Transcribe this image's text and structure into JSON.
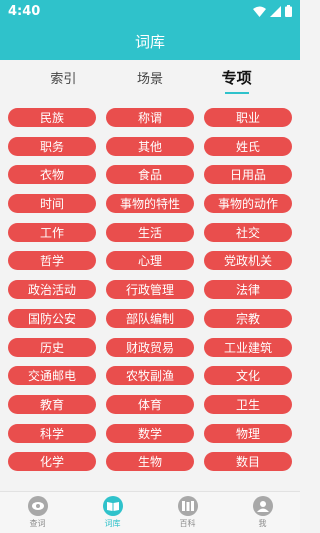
{
  "status": {
    "time": "4:40"
  },
  "header": {
    "title": "词库"
  },
  "tabs": [
    {
      "label": "索引",
      "active": false
    },
    {
      "label": "场景",
      "active": false
    },
    {
      "label": "专项",
      "active": true
    }
  ],
  "categories": [
    "民族",
    "称谓",
    "职业",
    "职务",
    "其他",
    "姓氏",
    "衣物",
    "食品",
    "日用品",
    "时间",
    "事物的特性",
    "事物的动作",
    "工作",
    "生活",
    "社交",
    "哲学",
    "心理",
    "党政机关",
    "政治活动",
    "行政管理",
    "法律",
    "国防公安",
    "部队编制",
    "宗教",
    "历史",
    "财政贸易",
    "工业建筑",
    "交通邮电",
    "农牧副渔",
    "文化",
    "教育",
    "体育",
    "卫生",
    "科学",
    "数学",
    "物理",
    "化学",
    "生物",
    "数目"
  ],
  "bottom_nav": [
    {
      "label": "查词",
      "icon": "eye-icon",
      "active": false
    },
    {
      "label": "词库",
      "icon": "book-icon",
      "active": true
    },
    {
      "label": "百科",
      "icon": "library-icon",
      "active": false
    },
    {
      "label": "我",
      "icon": "person-icon",
      "active": false
    }
  ],
  "colors": {
    "accent": "#2fc2cb",
    "chip": "#e94e4d"
  }
}
